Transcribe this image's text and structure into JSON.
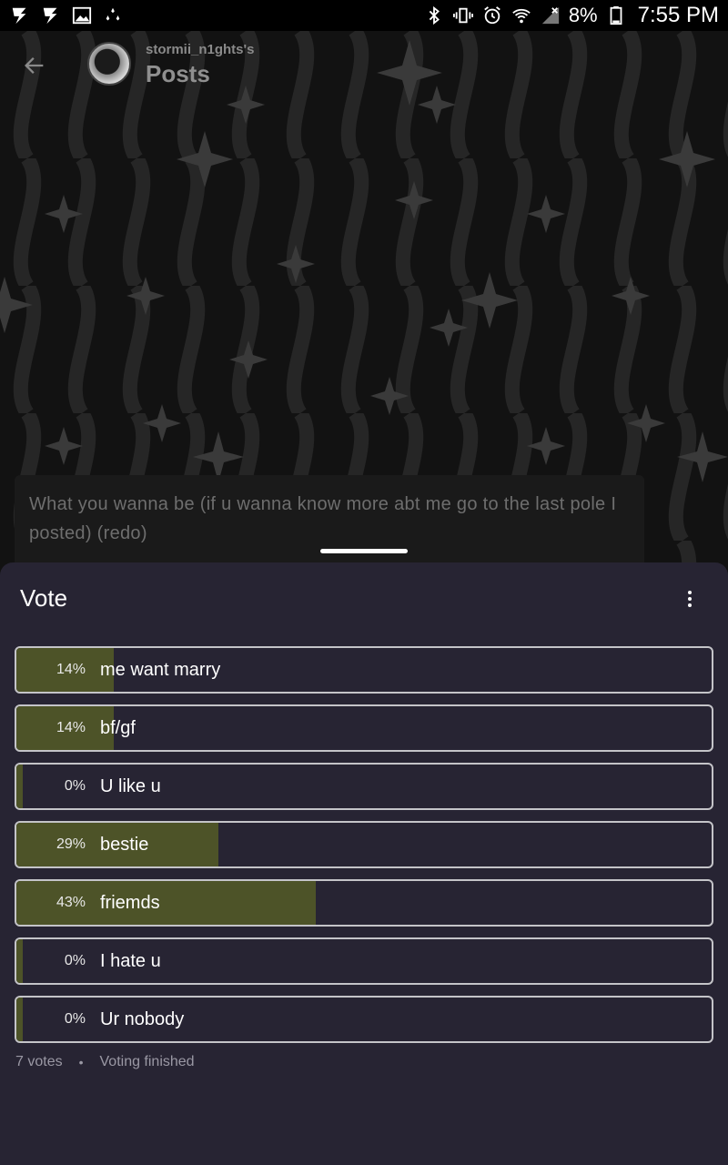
{
  "status_bar": {
    "battery_text": "8%",
    "time": "7:55 PM",
    "left_icons": [
      "bolt-icon",
      "bolt-icon",
      "image-icon",
      "sparkle-icon"
    ],
    "right_icons": [
      "bluetooth-icon",
      "vibrate-icon",
      "alarm-icon",
      "wifi-icon",
      "signal-icon",
      "battery-icon"
    ]
  },
  "header": {
    "owner": "stormii_n1ghts's",
    "title": "Posts"
  },
  "post": {
    "text": "What you wanna be (if u wanna know more abt me go to the last pole I posted) (redo)"
  },
  "poll": {
    "title": "Vote",
    "accent_color": "#4d5328",
    "options": [
      {
        "percent_text": "14%",
        "percent": 14,
        "label": "me want marry"
      },
      {
        "percent_text": "14%",
        "percent": 14,
        "label": "bf/gf"
      },
      {
        "percent_text": "0%",
        "percent": 0,
        "label": "U like u"
      },
      {
        "percent_text": "29%",
        "percent": 29,
        "label": "bestie"
      },
      {
        "percent_text": "43%",
        "percent": 43,
        "label": "friemds"
      },
      {
        "percent_text": "0%",
        "percent": 0,
        "label": "I hate u"
      },
      {
        "percent_text": "0%",
        "percent": 0,
        "label": "Ur nobody"
      }
    ],
    "votes_text": "7 votes",
    "separator": "•",
    "status_text": "Voting finished"
  }
}
